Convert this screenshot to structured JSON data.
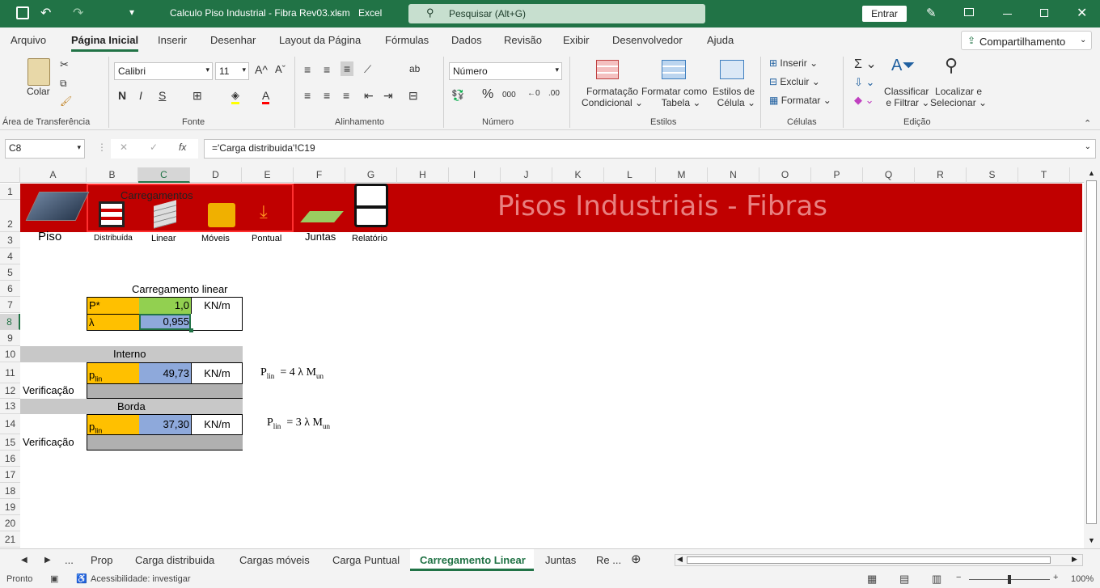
{
  "title": {
    "doc": "Calculo Piso Industrial - Fibra Rev03.xlsm",
    "app": "Excel",
    "search_placeholder": "Pesquisar (Alt+G)",
    "signin": "Entrar"
  },
  "menu": [
    "Arquivo",
    "Página Inicial",
    "Inserir",
    "Desenhar",
    "Layout da Página",
    "Fórmulas",
    "Dados",
    "Revisão",
    "Exibir",
    "Desenvolvedor",
    "Ajuda"
  ],
  "share": "Compartilhamento",
  "ribbon": {
    "paste": "Colar",
    "clipboard": "Área de Transferência",
    "font_name": "Calibri",
    "font_size": "11",
    "font_group": "Fonte",
    "align_group": "Alinhamento",
    "number_format": "Número",
    "number_group": "Número",
    "cond_format_1": "Formatação",
    "cond_format_2": "Condicional",
    "table_format_1": "Formatar como",
    "table_format_2": "Tabela",
    "cell_styles_1": "Estilos de",
    "cell_styles_2": "Célula",
    "styles_group": "Estilos",
    "insert": "Inserir",
    "delete": "Excluir",
    "format": "Formatar",
    "cells_group": "Células",
    "sort_1": "Classificar",
    "sort_2": "e Filtrar",
    "find_1": "Localizar e",
    "find_2": "Selecionar",
    "edit_group": "Edição",
    "bold": "N",
    "italic": "I",
    "underline": "S"
  },
  "formula": {
    "namebox": "C8",
    "fx": "fx",
    "content": "='Carga distribuida'!C19"
  },
  "columns": [
    "A",
    "B",
    "C",
    "D",
    "E",
    "F",
    "G",
    "H",
    "I",
    "J",
    "K",
    "L",
    "M",
    "N",
    "O",
    "P",
    "Q",
    "R",
    "S",
    "T"
  ],
  "rows": [
    "1",
    "2",
    "3",
    "4",
    "5",
    "6",
    "7",
    "8",
    "9",
    "10",
    "11",
    "12",
    "13",
    "14",
    "15",
    "16",
    "17",
    "18",
    "19",
    "20",
    "21"
  ],
  "sheet": {
    "banner_title": "Pisos Industriais - Fibras",
    "carregamentos": "Carregamentos",
    "nav": {
      "piso": "Piso",
      "distribuida": "Distribuída",
      "linear": "Linear",
      "moveis": "Móveis",
      "pontual": "Pontual",
      "juntas": "Juntas",
      "relatorio": "Relatório"
    },
    "section_title": "Carregamento linear",
    "p_label": "P*",
    "p_value": "1,0",
    "p_unit": "KN/m",
    "lambda_label": "λ",
    "lambda_value": "0,955",
    "interno": "Interno",
    "plin_label": "p",
    "plin_sub": "lin",
    "interno_value": "49,73",
    "unit": "KN/m",
    "verificacao": "Verificação",
    "borda": "Borda",
    "borda_value": "37,30",
    "formula1": {
      "p": "P",
      "sub": "lin",
      "eq": "= 4 λ M",
      "sub2": "un"
    },
    "formula2": {
      "p": "P",
      "sub": "lin",
      "eq": "= 3 λ M",
      "sub2": "un"
    }
  },
  "tabs": [
    "...",
    "Prop",
    "Carga distribuida",
    "Cargas móveis",
    "Carga Puntual",
    "Carregamento Linear",
    "Juntas",
    "Re ..."
  ],
  "active_tab": "Carregamento Linear",
  "status": {
    "ready": "Pronto",
    "access": "Acessibilidade: investigar",
    "zoom": "100%"
  },
  "colors": {
    "excel_green": "#217346",
    "banner_red": "#c00000",
    "cell_orange": "#ffc000",
    "cell_green": "#92d050",
    "cell_blue": "#8ea9db",
    "header_gray": "#c8c8c8"
  }
}
